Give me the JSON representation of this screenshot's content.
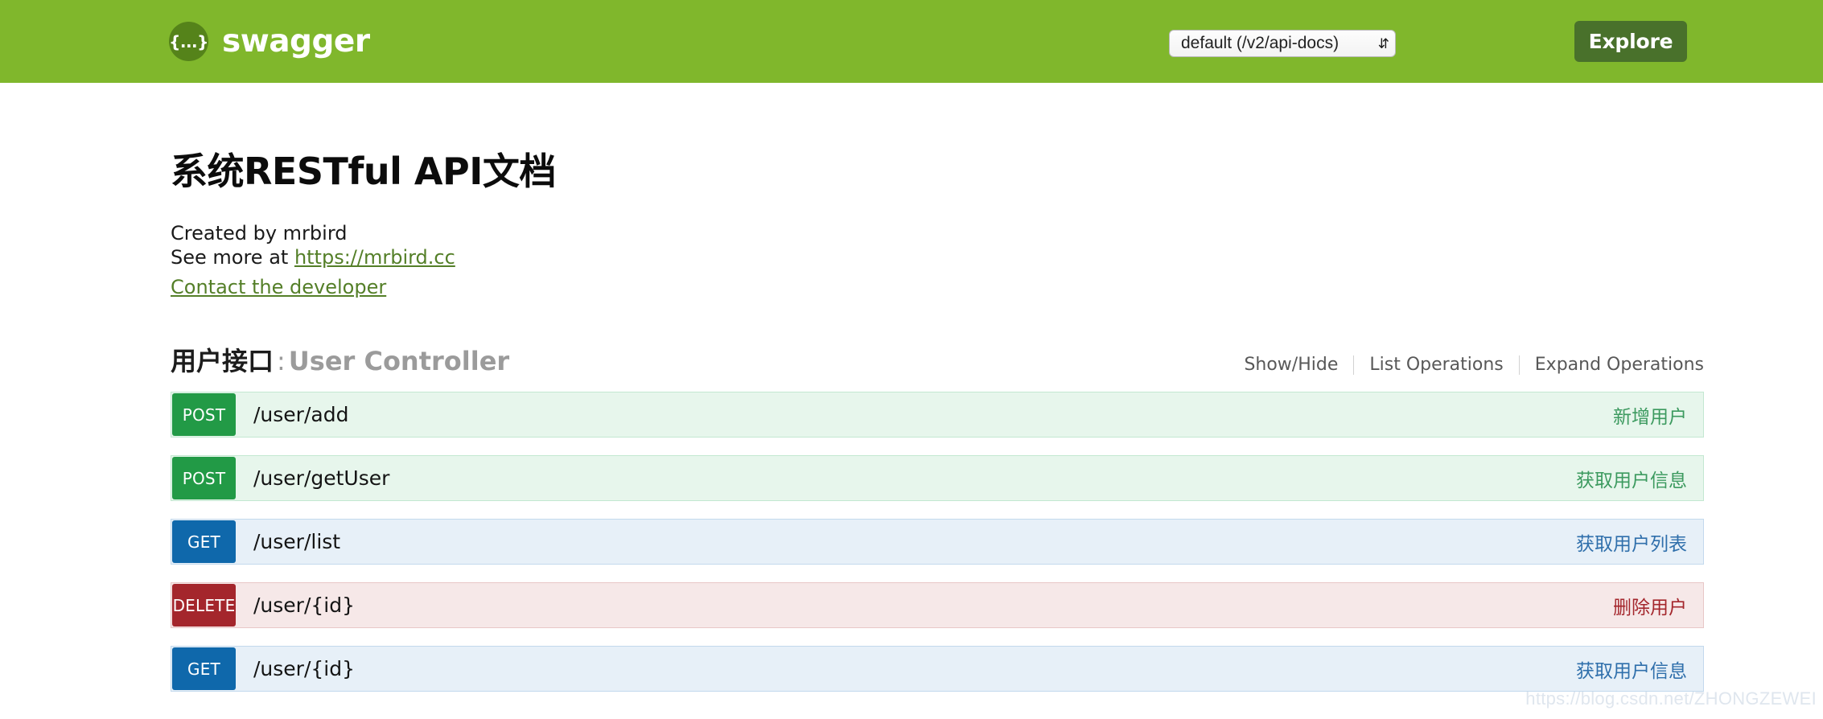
{
  "header": {
    "brand_name": "swagger",
    "logo_glyph": "{...}",
    "api_select_value": "default (/v2/api-docs)",
    "api_select_arrows": "⇵",
    "explore_label": "Explore"
  },
  "info": {
    "title": "系统RESTful API文档",
    "created_by": "Created by mrbird",
    "see_more_prefix": "See more at ",
    "see_more_link": "https://mrbird.cc",
    "contact_link": "Contact the developer"
  },
  "resource": {
    "title_cn": "用户接口",
    "separator": ":",
    "title_en": "User Controller",
    "options": {
      "show_hide": "Show/Hide",
      "list_operations": "List Operations",
      "expand_operations": "Expand Operations"
    }
  },
  "endpoints": [
    {
      "method": "POST",
      "path": "/user/add",
      "summary": "新增用户",
      "style": "post"
    },
    {
      "method": "POST",
      "path": "/user/getUser",
      "summary": "获取用户信息",
      "style": "post"
    },
    {
      "method": "GET",
      "path": "/user/list",
      "summary": "获取用户列表",
      "style": "get"
    },
    {
      "method": "DELETE",
      "path": "/user/{id}",
      "summary": "删除用户",
      "style": "del"
    },
    {
      "method": "GET",
      "path": "/user/{id}",
      "summary": "获取用户信息",
      "style": "get"
    }
  ],
  "watermark": "https://blog.csdn.net/ZHONGZEWEI",
  "colors": {
    "header_green": "#80b72c",
    "logo_green": "#55831a",
    "explore_green": "#49712b",
    "post_green": "#229a46",
    "get_blue": "#0f68ab",
    "delete_red": "#a4262c",
    "link_green": "#547f28"
  }
}
